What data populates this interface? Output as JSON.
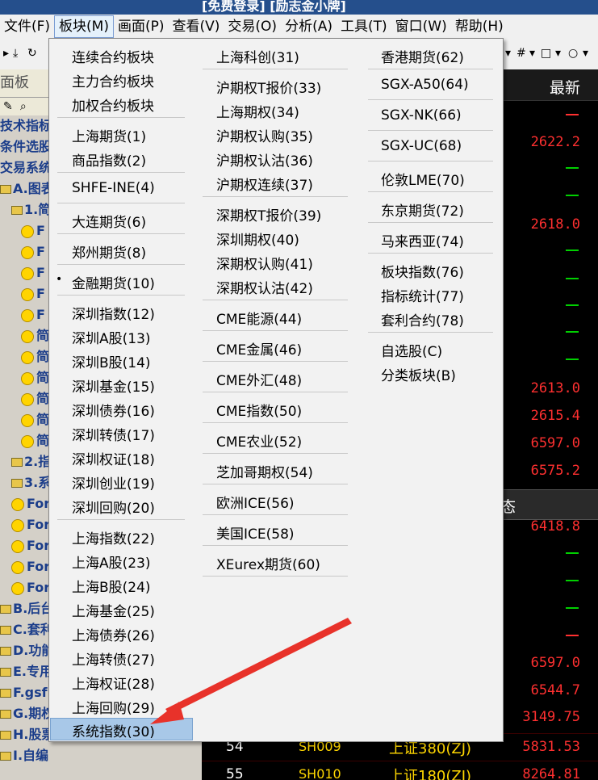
{
  "window_title": "[免费登录] [励志金小牌]",
  "menubar": [
    "文件(F)",
    "板块(M)",
    "画面(P)",
    "查看(V)",
    "交易(O)",
    "分析(A)",
    "工具(T)",
    "窗口(W)",
    "帮助(H)"
  ],
  "left_panel": {
    "header": "面板",
    "rows": [
      "技术指标",
      "条件选股",
      "交易系统",
      "A.图表",
      "1.简",
      "F",
      "F",
      "F",
      "F",
      "F",
      "简",
      "简",
      "简",
      "简",
      "简",
      "简",
      "2.指",
      "3.系",
      "Form",
      "Form",
      "Form",
      "Form",
      "Form",
      "B.后台",
      "C.套利",
      "D.功能",
      "E.专用",
      "F.gsf",
      "G.期权",
      "H.股票模块范例",
      "I.自编"
    ]
  },
  "grid": {
    "header": "最新",
    "prices": [
      "2622.2",
      "2618.0",
      "2613.0",
      "2615.4",
      "6597.0",
      "6575.2",
      "6418.8",
      "6597.0",
      "6544.7",
      "3149.75"
    ],
    "panel_label": "态",
    "rows": [
      {
        "num": "54",
        "code": "SH009",
        "name": "上证380(ZJ)",
        "price": "5831.53"
      },
      {
        "num": "55",
        "code": "SH010",
        "name": "上证180(ZJ)",
        "price": "8264.81"
      }
    ]
  },
  "menu": {
    "col1": [
      {
        "label": "连续合约板块"
      },
      {
        "label": "主力合约板块"
      },
      {
        "label": "加权合约板块"
      },
      {
        "label": "上海期货(1)"
      },
      {
        "label": "商品指数(2)"
      },
      {
        "label": "SHFE-INE(4)"
      },
      {
        "label": "大连期货(6)"
      },
      {
        "label": "郑州期货(8)"
      },
      {
        "label": "金融期货(10)",
        "checked": true
      },
      {
        "label": "深圳指数(12)"
      },
      {
        "label": "深圳A股(13)"
      },
      {
        "label": "深圳B股(14)"
      },
      {
        "label": "深圳基金(15)"
      },
      {
        "label": "深圳债券(16)"
      },
      {
        "label": "深圳转债(17)"
      },
      {
        "label": "深圳权证(18)"
      },
      {
        "label": "深圳创业(19)"
      },
      {
        "label": "深圳回购(20)"
      },
      {
        "label": "上海指数(22)"
      },
      {
        "label": "上海A股(23)"
      },
      {
        "label": "上海B股(24)"
      },
      {
        "label": "上海基金(25)"
      },
      {
        "label": "上海债券(26)"
      },
      {
        "label": "上海转债(27)"
      },
      {
        "label": "上海权证(28)"
      },
      {
        "label": "上海回购(29)"
      },
      {
        "label": "系统指数(30)",
        "highlighted": true
      }
    ],
    "col2": [
      "上海科创(31)",
      "沪期权T报价(33)",
      "上海期权(34)",
      "沪期权认购(35)",
      "沪期权认沽(36)",
      "沪期权连续(37)",
      "深期权T报价(39)",
      "深圳期权(40)",
      "深期权认购(41)",
      "深期权认沽(42)",
      "CME能源(44)",
      "CME金属(46)",
      "CME外汇(48)",
      "CME指数(50)",
      "CME农业(52)",
      "芝加哥期权(54)",
      "欧洲ICE(56)",
      "美国ICE(58)",
      "XEurex期货(60)"
    ],
    "col3": [
      "香港期货(62)",
      "SGX-A50(64)",
      "SGX-NK(66)",
      "SGX-UC(68)",
      "伦敦LME(70)",
      "东京期货(72)",
      "马来西亚(74)",
      "板块指数(76)",
      "指标统计(77)",
      "套利合约(78)",
      "自选股(C)",
      "分类板块(B)"
    ]
  },
  "colors": {
    "highlight": "#a8c8e8",
    "arrow": "#e8322a",
    "price_red": "#ff3030",
    "price_green": "#00d000"
  }
}
